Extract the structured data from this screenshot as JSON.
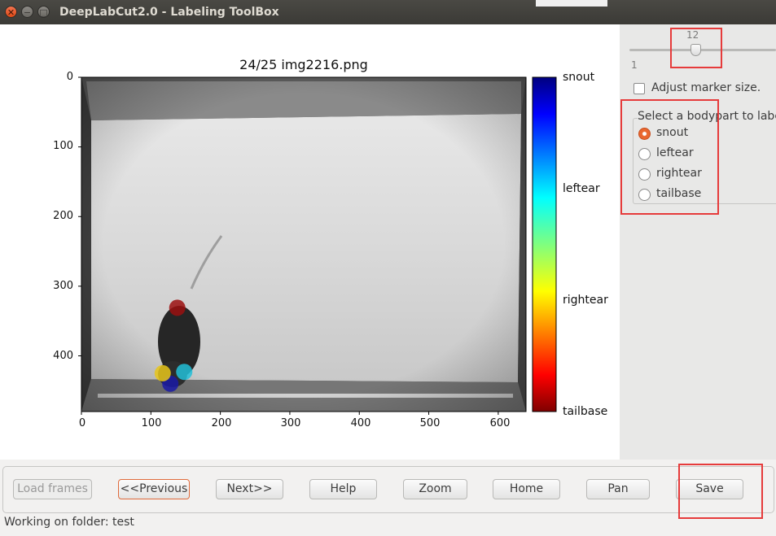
{
  "window": {
    "title": "DeepLabCut2.0 - Labeling ToolBox"
  },
  "plot": {
    "title": "24/25 img2216.png",
    "y_ticks": [
      "0",
      "100",
      "200",
      "300",
      "400"
    ],
    "x_ticks": [
      "0",
      "100",
      "200",
      "300",
      "400",
      "500",
      "600"
    ],
    "colorbar_labels": [
      "snout",
      "leftear",
      "rightear",
      "tailbase"
    ],
    "markers": [
      {
        "bodypart": "snout",
        "x": 128,
        "y": 440,
        "color": "#1a1aa6"
      },
      {
        "bodypart": "leftear",
        "x": 148,
        "y": 423,
        "color": "#22c0d8"
      },
      {
        "bodypart": "rightear",
        "x": 117,
        "y": 425,
        "color": "#e8c51a"
      },
      {
        "bodypart": "tailbase",
        "x": 138,
        "y": 331,
        "color": "#9b1010"
      }
    ]
  },
  "sidebar": {
    "slider_value": "12",
    "slider_min": "1",
    "adjust_marker_label": "Adjust marker size.",
    "bodypart_group_label": "Select a bodypart to label",
    "bodyparts": [
      "snout",
      "leftear",
      "rightear",
      "tailbase"
    ],
    "selected_bodypart": "snout"
  },
  "buttons": {
    "load": "Load frames",
    "previous": "<<Previous",
    "next": "Next>>",
    "help": "Help",
    "zoom": "Zoom",
    "home": "Home",
    "pan": "Pan",
    "save": "Save"
  },
  "status": {
    "text": "Working on folder: test"
  },
  "colors": {
    "accent": "#e9672f",
    "highlight_box": "#e63b3b"
  }
}
